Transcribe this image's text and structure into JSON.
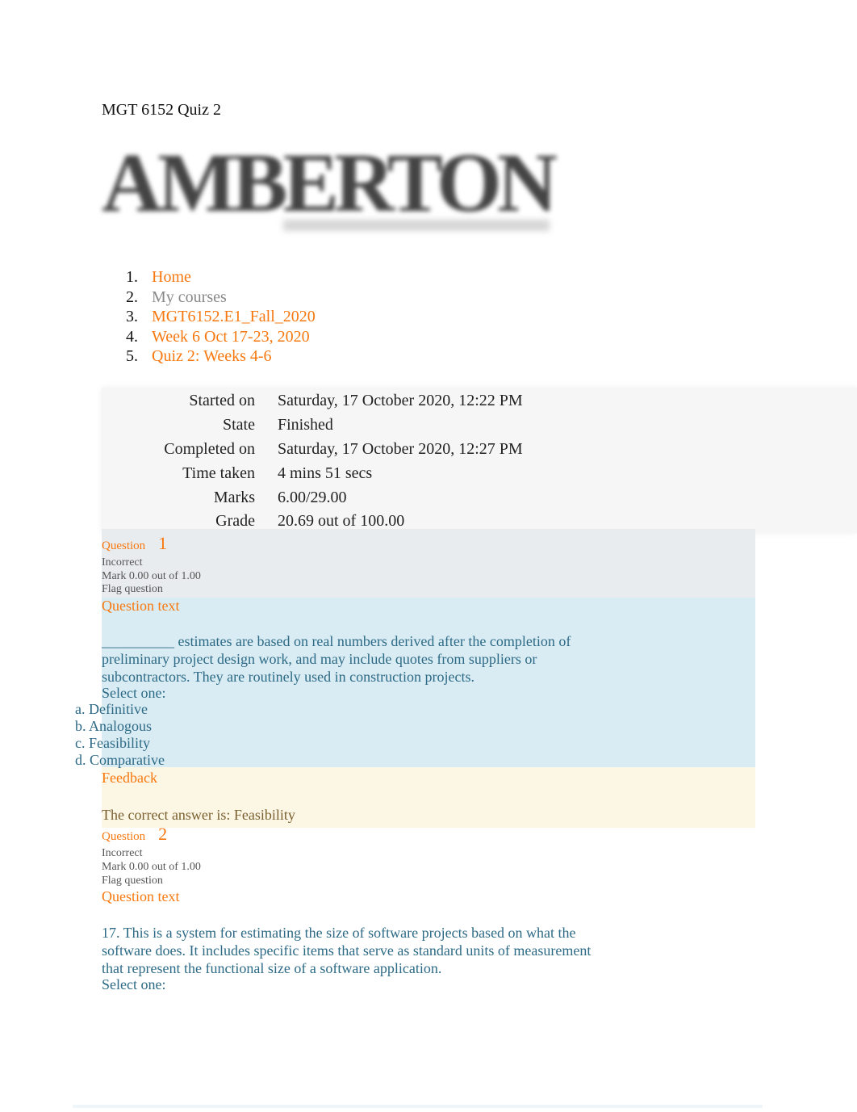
{
  "document_title": "MGT 6152 Quiz 2",
  "logo": {
    "text": "AMBERTON"
  },
  "colors": {
    "link": "#f7780f",
    "question_text": "#2d6a86",
    "feedback_text": "#7a6030"
  },
  "breadcrumb": [
    {
      "num": "1.",
      "label": "Home",
      "link": true
    },
    {
      "num": "2.",
      "label": "My courses",
      "link": false
    },
    {
      "num": "3.",
      "label": "MGT6152.E1_Fall_2020",
      "link": true
    },
    {
      "num": "4.",
      "label": "Week 6 Oct 17-23, 2020",
      "link": true
    },
    {
      "num": "5.",
      "label": "Quiz 2: Weeks 4-6",
      "link": true
    }
  ],
  "summary": [
    {
      "label": "Started on",
      "value": "Saturday, 17 October 2020, 12:22 PM"
    },
    {
      "label": "State",
      "value": "Finished"
    },
    {
      "label": "Completed on",
      "value": "Saturday, 17 October 2020, 12:27 PM"
    },
    {
      "label": "Time taken",
      "value": "4 mins 51 secs"
    },
    {
      "label": "Marks",
      "value": "6.00/29.00"
    },
    {
      "label": "Grade",
      "value": "20.69 out of 100.00"
    }
  ],
  "questions": [
    {
      "label": "Question",
      "number": "1",
      "status": "Incorrect",
      "mark": "Mark 0.00 out of 1.00",
      "flag": "Flag question",
      "text_heading": "Question text",
      "lines": [
        "__________ estimates are based on real numbers derived after the completion of",
        "preliminary project design work, and may include quotes from suppliers or",
        "subcontractors. They are routinely used in construction projects."
      ],
      "select": "Select one:",
      "options": [
        "a. Definitive",
        "b. Analogous",
        "c. Feasibility",
        "d. Comparative"
      ],
      "feedback_heading": "Feedback",
      "feedback": "The correct answer is: Feasibility"
    },
    {
      "label": "Question",
      "number": "2",
      "status": "Incorrect",
      "mark": "Mark 0.00 out of 1.00",
      "flag": "Flag question",
      "text_heading": "Question text",
      "lines": [
        "17. This is a system for estimating the size of software projects based on what the",
        "software does. It includes specific items that serve as standard units of measurement",
        "that represent the functional size of a software application."
      ],
      "select": "Select one:"
    }
  ]
}
